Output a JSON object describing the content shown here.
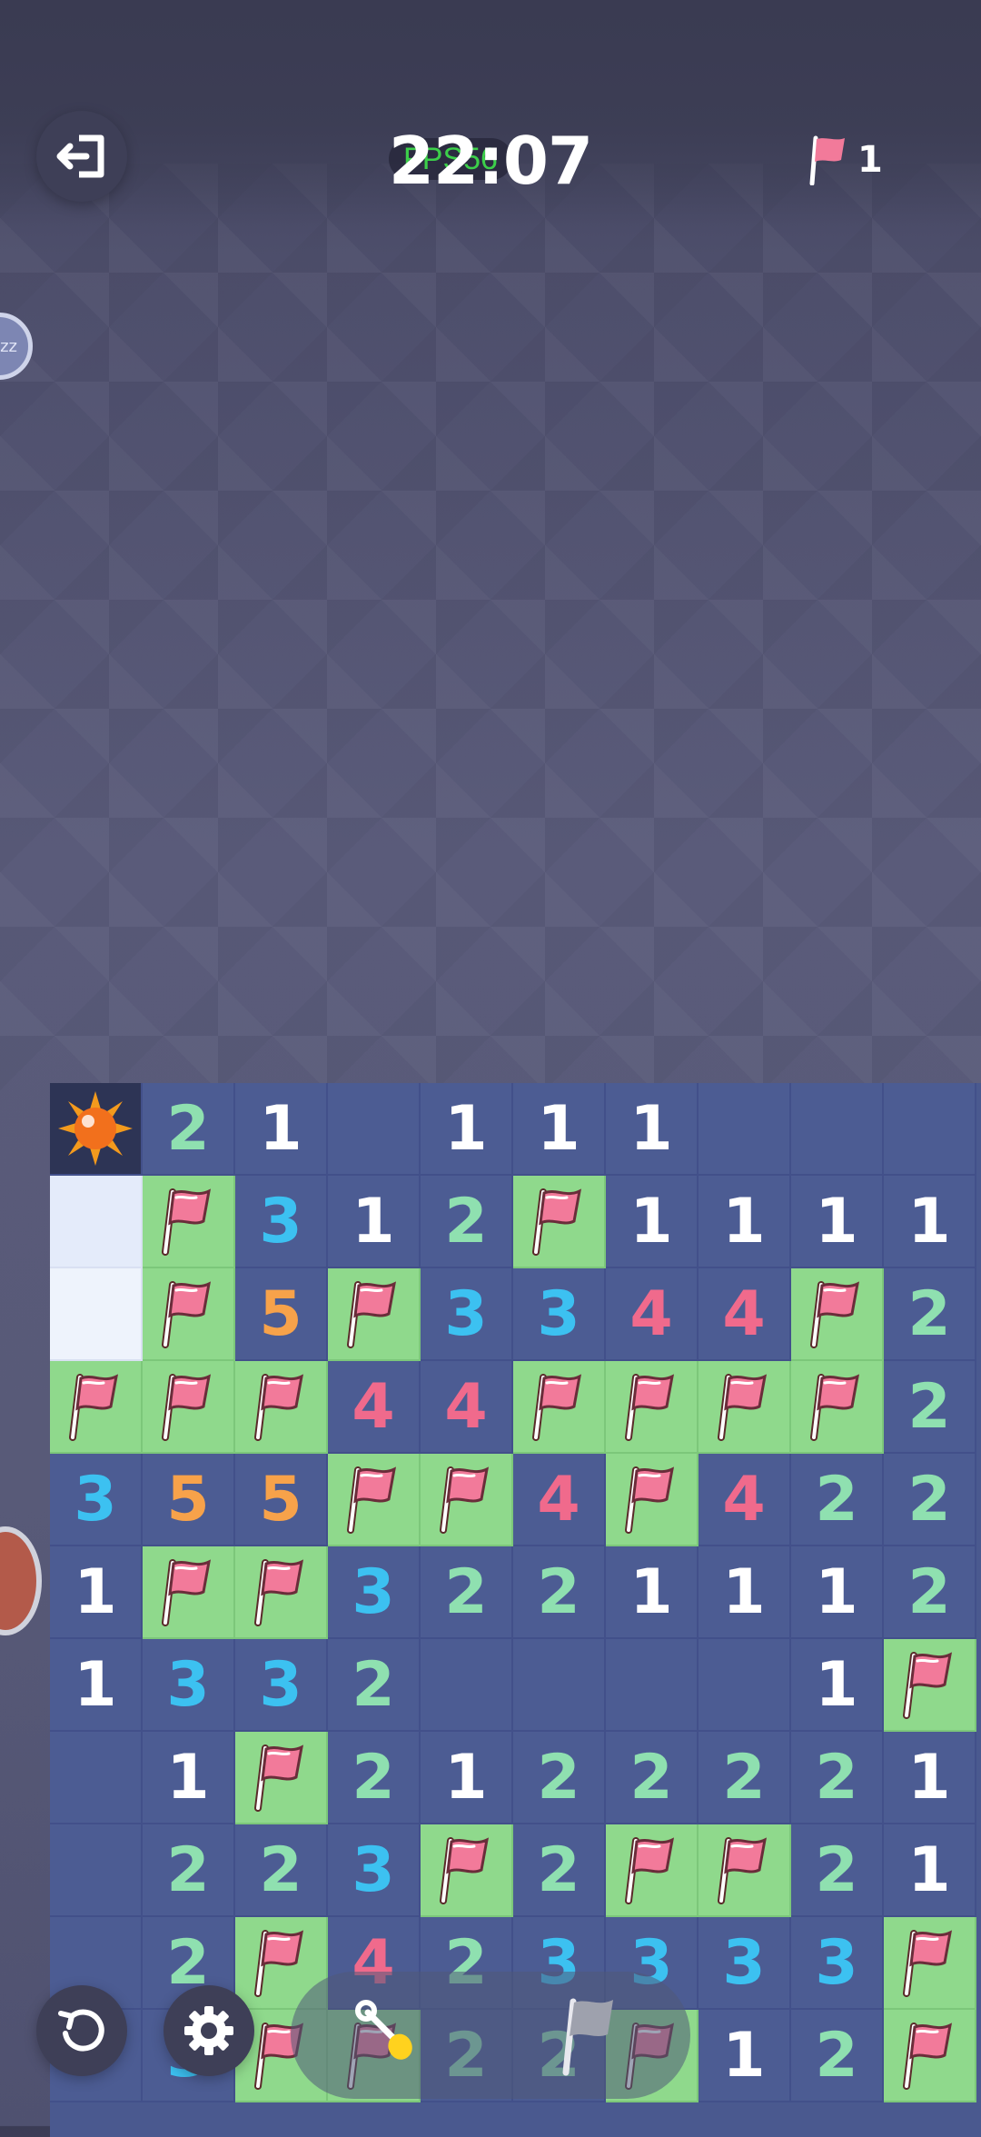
{
  "header": {
    "timer": "22:07",
    "fps": "FPS56",
    "flag_count": "1"
  },
  "board": {
    "rows": [
      [
        "bomb",
        "2",
        "1",
        "",
        "1",
        "1",
        "1",
        "",
        "",
        ""
      ],
      [
        "hidden",
        "F",
        "3",
        "1",
        "2",
        "F",
        "1",
        "1",
        "1",
        "1"
      ],
      [
        "hidden2",
        "F",
        "5",
        "F",
        "3",
        "3",
        "4",
        "4",
        "F",
        "2"
      ],
      [
        "F",
        "F",
        "F",
        "4",
        "4",
        "F",
        "F",
        "F",
        "F",
        "2"
      ],
      [
        "3",
        "5",
        "5",
        "F",
        "F",
        "4",
        "F",
        "4",
        "2",
        "2"
      ],
      [
        "1",
        "F",
        "F",
        "3",
        "2",
        "2",
        "1",
        "1",
        "1",
        "2"
      ],
      [
        "1",
        "3",
        "3",
        "2",
        "",
        "",
        "",
        "",
        "1",
        "F"
      ],
      [
        "",
        "1",
        "F",
        "2",
        "1",
        "2",
        "2",
        "2",
        "2",
        "1"
      ],
      [
        "",
        "2",
        "2",
        "3",
        "F",
        "2",
        "F",
        "F",
        "2",
        "1"
      ],
      [
        "",
        "2",
        "F",
        "4",
        "2",
        "3",
        "3",
        "3",
        "3",
        "F"
      ],
      [
        "",
        "3",
        "F",
        "F",
        "2",
        "2",
        "F",
        "1",
        "2",
        "F"
      ]
    ]
  },
  "controls": {
    "restart": "restart-icon",
    "settings": "gear-icon",
    "modes": [
      "shovel-icon",
      "flag-icon"
    ]
  }
}
